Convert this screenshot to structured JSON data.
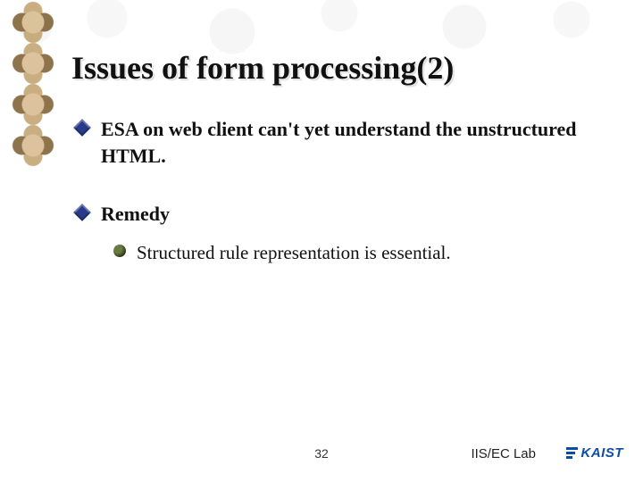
{
  "title": "Issues of form processing(2)",
  "bullets": [
    {
      "text": "ESA on web client can't yet understand the unstructured HTML."
    },
    {
      "text": "Remedy",
      "sub": [
        {
          "text": "Structured rule representation is essential."
        }
      ]
    }
  ],
  "footer": {
    "page": "32",
    "lab": "IIS/EC Lab",
    "logo": "KAIST"
  }
}
